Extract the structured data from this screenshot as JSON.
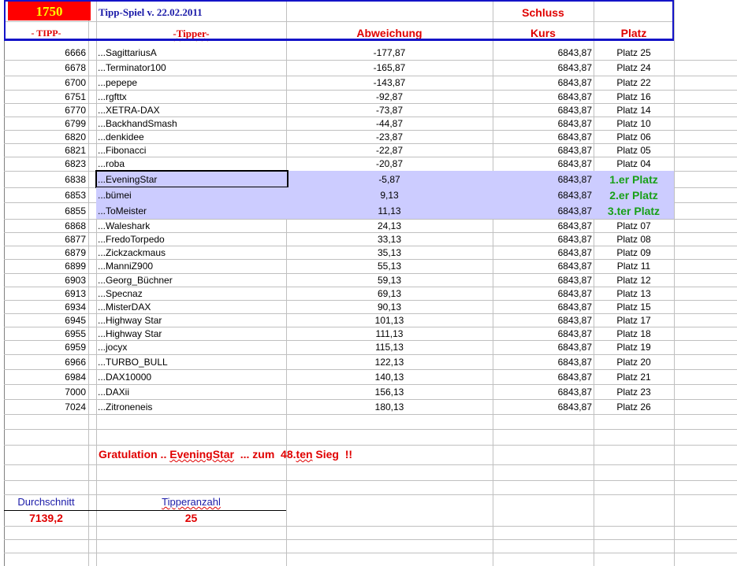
{
  "header": {
    "code": "1750",
    "title": "Tipp-Spiel v. 22.02.2011",
    "schluss": "Schluss",
    "tipp": "- TIPP-",
    "tipper": "-Tipper-",
    "abweichung": "Abweichung",
    "kurs": "Kurs",
    "platz": "Platz"
  },
  "rows": [
    {
      "tipp": "6666",
      "name": "...SagittariusA",
      "abw": "-177,87",
      "kurs": "6843,87",
      "platz": "Platz 25"
    },
    {
      "tipp": "6678",
      "name": "...Terminator100",
      "abw": "-165,87",
      "kurs": "6843,87",
      "platz": "Platz 24"
    },
    {
      "tipp": "6700",
      "name": "...pepepe",
      "abw": "-143,87",
      "kurs": "6843,87",
      "platz": "Platz 22"
    },
    {
      "tipp": "6751",
      "name": "...rgfttx",
      "abw": "-92,87",
      "kurs": "6843,87",
      "platz": "Platz 16"
    },
    {
      "tipp": "6770",
      "name": "...XETRA-DAX",
      "abw": "-73,87",
      "kurs": "6843,87",
      "platz": "Platz 14"
    },
    {
      "tipp": "6799",
      "name": "...BackhandSmash",
      "abw": "-44,87",
      "kurs": "6843,87",
      "platz": "Platz 10"
    },
    {
      "tipp": "6820",
      "name": "...denkidee",
      "abw": "-23,87",
      "kurs": "6843,87",
      "platz": "Platz 06"
    },
    {
      "tipp": "6821",
      "name": "...Fibonacci",
      "abw": "-22,87",
      "kurs": "6843,87",
      "platz": "Platz 05"
    },
    {
      "tipp": "6823",
      "name": "...roba",
      "abw": "-20,87",
      "kurs": "6843,87",
      "platz": "Platz 04"
    },
    {
      "tipp": "6838",
      "name": "...EveningStar",
      "abw": "-5,87",
      "kurs": "6843,87",
      "platz": "1.er Platz",
      "winner": true
    },
    {
      "tipp": "6853",
      "name": "...bümei",
      "abw": "9,13",
      "kurs": "6843,87",
      "platz": "2.er Platz",
      "winner": true
    },
    {
      "tipp": "6855",
      "name": "...ToMeister",
      "abw": "11,13",
      "kurs": "6843,87",
      "platz": "3.ter Platz",
      "winner": true
    },
    {
      "tipp": "6868",
      "name": "...Waleshark",
      "abw": "24,13",
      "kurs": "6843,87",
      "platz": "Platz 07"
    },
    {
      "tipp": "6877",
      "name": "...FredoTorpedo",
      "abw": "33,13",
      "kurs": "6843,87",
      "platz": "Platz 08"
    },
    {
      "tipp": "6879",
      "name": "...Zickzackmaus",
      "abw": "35,13",
      "kurs": "6843,87",
      "platz": "Platz 09"
    },
    {
      "tipp": "6899",
      "name": "...ManniZ900",
      "abw": "55,13",
      "kurs": "6843,87",
      "platz": "Platz 11"
    },
    {
      "tipp": "6903",
      "name": "...Georg_Büchner",
      "abw": "59,13",
      "kurs": "6843,87",
      "platz": "Platz 12"
    },
    {
      "tipp": "6913",
      "name": "...Specnaz",
      "abw": "69,13",
      "kurs": "6843,87",
      "platz": "Platz 13"
    },
    {
      "tipp": "6934",
      "name": "...MisterDAX",
      "abw": "90,13",
      "kurs": "6843,87",
      "platz": "Platz 15"
    },
    {
      "tipp": "6945",
      "name": "...Highway Star",
      "abw": "101,13",
      "kurs": "6843,87",
      "platz": "Platz 17"
    },
    {
      "tipp": "6955",
      "name": "...Highway Star",
      "abw": "111,13",
      "kurs": "6843,87",
      "platz": "Platz 18"
    },
    {
      "tipp": "6959",
      "name": "...jocyx",
      "abw": "115,13",
      "kurs": "6843,87",
      "platz": "Platz 19"
    },
    {
      "tipp": "6966",
      "name": "...TURBO_BULL",
      "abw": "122,13",
      "kurs": "6843,87",
      "platz": "Platz 20"
    },
    {
      "tipp": "6984",
      "name": "...DAX10000",
      "abw": "140,13",
      "kurs": "6843,87",
      "platz": "Platz 21"
    },
    {
      "tipp": "7000",
      "name": "...DAXii",
      "abw": "156,13",
      "kurs": "6843,87",
      "platz": "Platz 23"
    },
    {
      "tipp": "7024",
      "name": "...Zitroneneis",
      "abw": "180,13",
      "kurs": "6843,87",
      "platz": "Platz 26"
    }
  ],
  "congrats": {
    "a": "Gratulation .. ",
    "name": "EveningStar",
    "b": "  ... zum  48.",
    "ten": "ten",
    "c": " Sieg  !!"
  },
  "summary": {
    "avg_label": "Durchschnitt",
    "avg": "7139,2",
    "count_label": "Tipperanzahl",
    "count": "25"
  }
}
